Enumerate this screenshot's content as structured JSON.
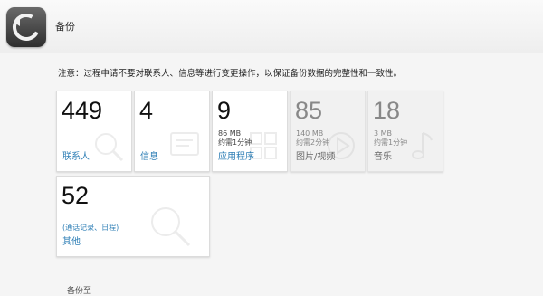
{
  "window": {
    "title": "备份"
  },
  "notice": "注意：过程中请不要对联系人、信息等进行变更操作，以保证备份数据的完整性和一致性。",
  "tiles": [
    {
      "count": "449",
      "label": "联系人",
      "size": "",
      "time": "",
      "enabled": true,
      "icon": "search-icon"
    },
    {
      "count": "4",
      "label": "信息",
      "size": "",
      "time": "",
      "enabled": true,
      "icon": "message-icon"
    },
    {
      "count": "9",
      "label": "应用程序",
      "size": "86 MB",
      "time": "约需1分钟",
      "enabled": true,
      "icon": "apps-icon"
    },
    {
      "count": "85",
      "label": "图片/视频",
      "size": "140 MB",
      "time": "约需2分钟",
      "enabled": false,
      "icon": "play-icon"
    },
    {
      "count": "18",
      "label": "音乐",
      "size": "3 MB",
      "time": "约需1分钟",
      "enabled": false,
      "icon": "music-note-icon"
    },
    {
      "count": "52",
      "label": "其他",
      "size": "",
      "time": "",
      "enabled": true,
      "icon": "search-icon",
      "extra": "(通话记录、日程)"
    }
  ],
  "footer": {
    "backup_to_label": "备份至"
  }
}
